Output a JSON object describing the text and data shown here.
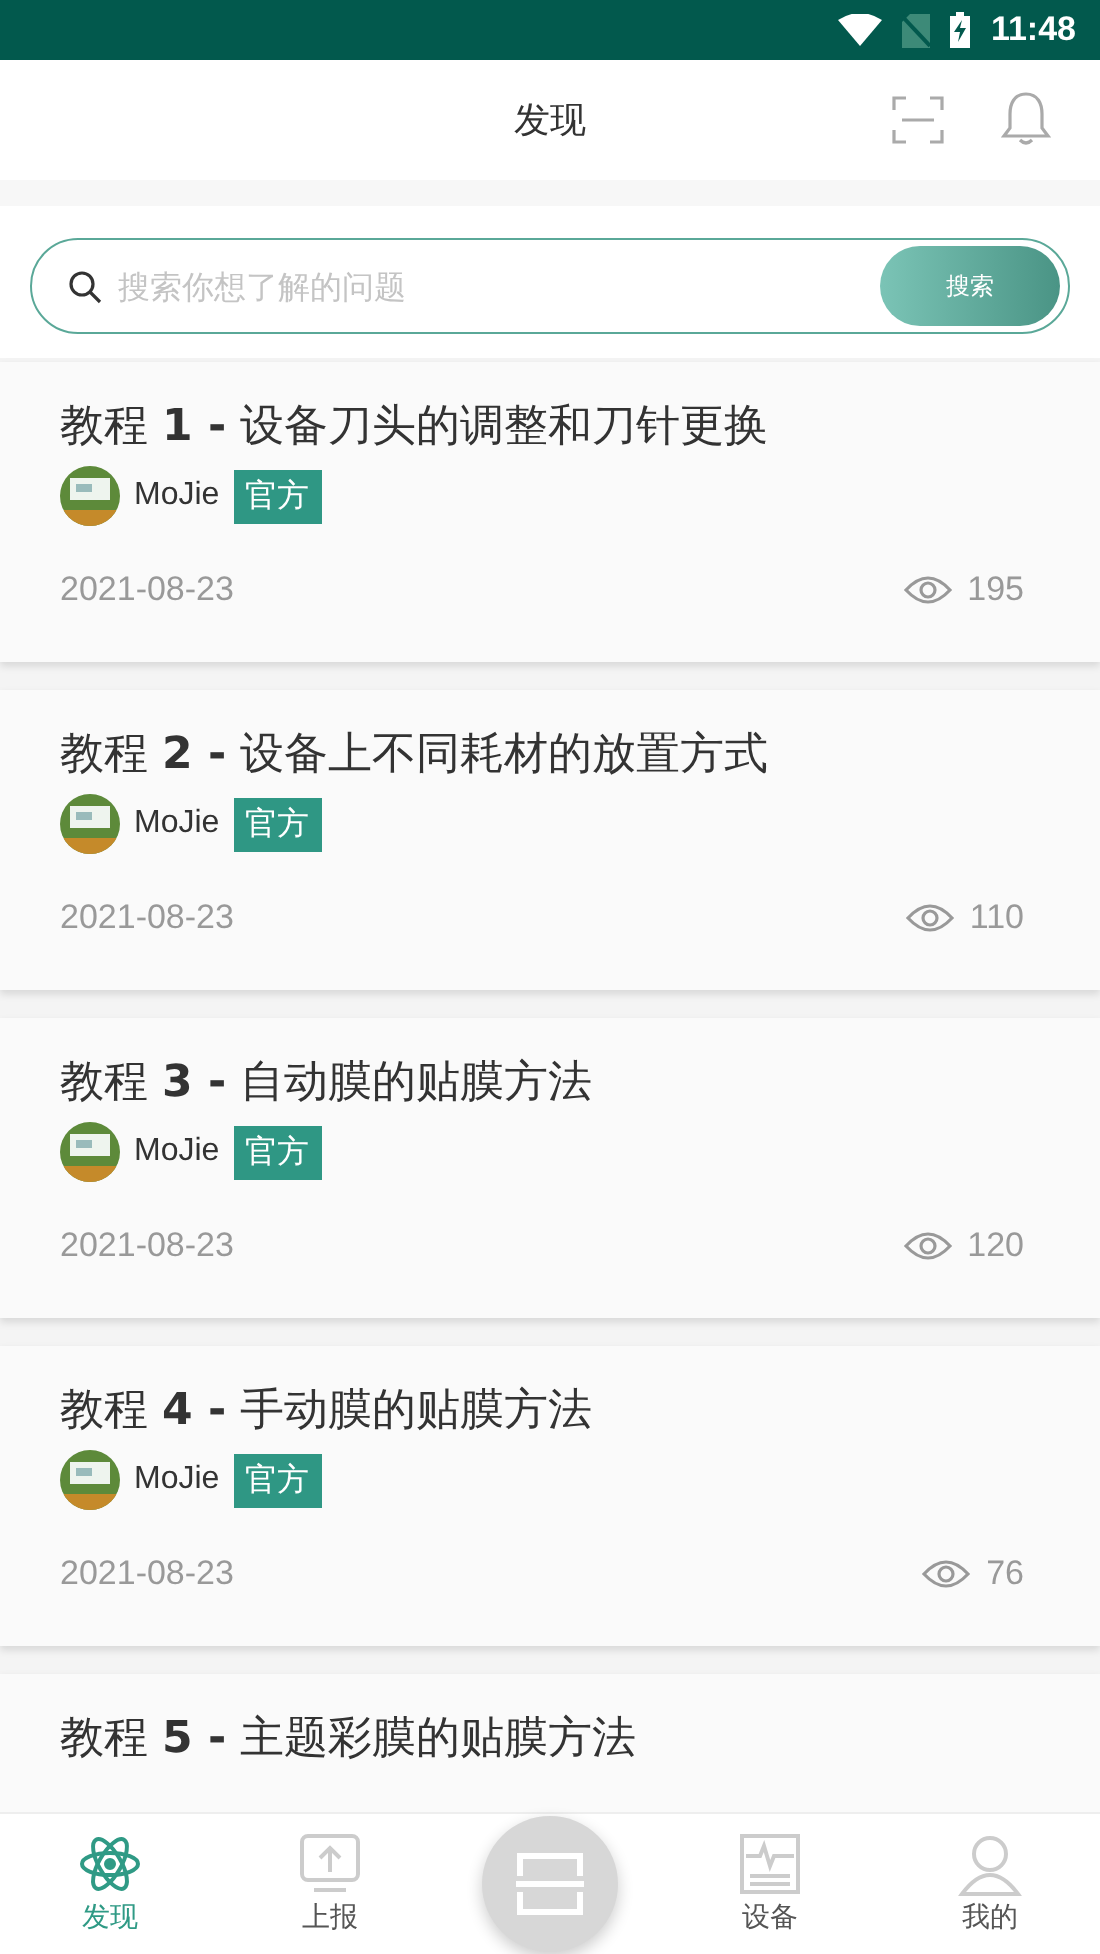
{
  "status_bar": {
    "time": "11:48"
  },
  "header": {
    "title": "发现"
  },
  "search": {
    "placeholder": "搜索你想了解的问题",
    "button": "搜索"
  },
  "posts": [
    {
      "prefix": "教程 ",
      "number": "1 -",
      "title": " 设备刀头的调整和刀针更换",
      "author": "MoJie",
      "badge": "官方",
      "date": "2021-08-23",
      "views": "195"
    },
    {
      "prefix": "教程 ",
      "number": "2 -",
      "title": " 设备上不同耗材的放置方式",
      "author": "MoJie",
      "badge": "官方",
      "date": "2021-08-23",
      "views": "110"
    },
    {
      "prefix": "教程 ",
      "number": "3 -",
      "title": " 自动膜的贴膜方法",
      "author": "MoJie",
      "badge": "官方",
      "date": "2021-08-23",
      "views": "120"
    },
    {
      "prefix": "教程 ",
      "number": "4 -",
      "title": " 手动膜的贴膜方法",
      "author": "MoJie",
      "badge": "官方",
      "date": "2021-08-23",
      "views": "76"
    },
    {
      "prefix": "教程 ",
      "number": "5 -",
      "title": " 主题彩膜的贴膜方法"
    }
  ],
  "tabs": [
    {
      "kind": "discover",
      "label": "发现",
      "selected": true
    },
    {
      "kind": "report",
      "label": "上报",
      "selected": false
    },
    {
      "kind": "scan"
    },
    {
      "kind": "device",
      "label": "设备",
      "selected": false
    },
    {
      "kind": "me",
      "label": "我的",
      "selected": false
    }
  ]
}
